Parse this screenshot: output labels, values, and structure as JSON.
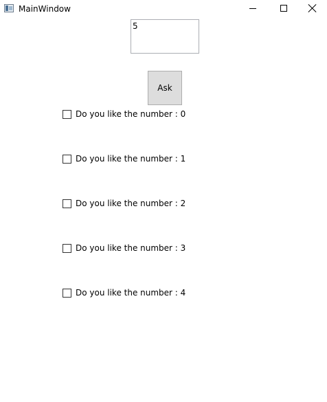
{
  "window": {
    "title": "MainWindow",
    "icon": "app-window-icon",
    "controls": {
      "minimize": "minimize-icon",
      "maximize": "maximize-icon",
      "close": "close-icon"
    }
  },
  "main": {
    "input": {
      "value": "5"
    },
    "ask_button": {
      "label": "Ask"
    },
    "checkboxes": [
      {
        "label": "Do you like the number : 0",
        "checked": false
      },
      {
        "label": "Do you like the number : 1",
        "checked": false
      },
      {
        "label": "Do you like the number : 2",
        "checked": false
      },
      {
        "label": "Do you like the number : 3",
        "checked": false
      },
      {
        "label": "Do you like the number : 4",
        "checked": false
      }
    ]
  }
}
